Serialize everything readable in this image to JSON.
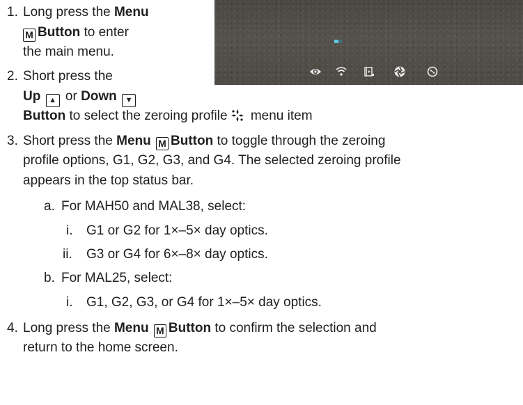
{
  "device": {
    "icons": [
      "eye-icon",
      "wifi-icon",
      "video-record-icon",
      "shutter-icon",
      "settings-wheel-icon"
    ],
    "status_color": "#5fc8e6"
  },
  "steps": {
    "s1": {
      "num": "1.",
      "l1_a": "Long press the ",
      "l1_b": "Menu",
      "key": "M",
      "l2_b": "Button",
      "l2_c": " to enter",
      "l3": "the main menu."
    },
    "s2": {
      "num": "2.",
      "l1": "Short press the",
      "up": "Up",
      "up_key": "▲",
      "or": " or ",
      "down": "Down",
      "down_key": "▼",
      "button": "Button",
      "rest": " to select the zeroing profile",
      "menu_item": " menu item"
    },
    "s3": {
      "num": "3.",
      "l1_a": "Short press the ",
      "l1_b": "Menu",
      "key": "M",
      "l1_c": "Button",
      "l1_d": " to toggle through the zeroing",
      "l2": "profile options, G1, G2, G3, and G4. The selected zeroing profile",
      "l3": "appears in the top status bar."
    },
    "sub_a": {
      "marker": "a.",
      "text": "For MAH50 and MAL38, select:",
      "i": {
        "marker": "i.",
        "text": "G1 or G2 for 1×–5× day optics."
      },
      "ii": {
        "marker": "ii.",
        "text": "G3 or G4 for 6×–8× day optics."
      }
    },
    "sub_b": {
      "marker": "b.",
      "text": "For MAL25, select:",
      "i": {
        "marker": "i.",
        "text": "G1, G2, G3, or G4 for 1×–5× day optics."
      }
    },
    "s4": {
      "num": "4.",
      "l1_a": "Long press the ",
      "l1_b": "Menu",
      "key": "M",
      "l1_c": "Button",
      "l1_d": " to confirm the selection and",
      "l2": "return to the home screen."
    }
  }
}
